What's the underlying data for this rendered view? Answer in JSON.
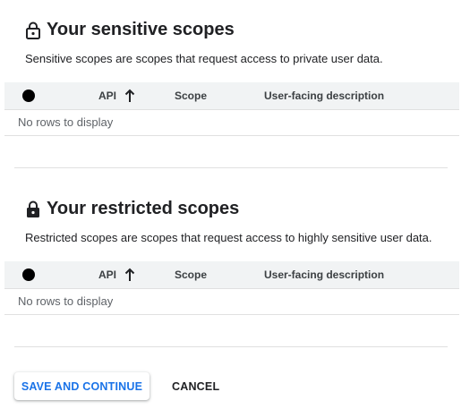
{
  "sensitive": {
    "title": "Your sensitive scopes",
    "title_icon": "lock-open-outline-icon",
    "description": "Sensitive scopes are scopes that request access to private user data.",
    "columns": [
      "API",
      "Scope",
      "User-facing description"
    ],
    "sort_icon": "arrow-up-icon",
    "empty_text": "No rows to display"
  },
  "restricted": {
    "title": "Your restricted scopes",
    "title_icon": "lock-filled-icon",
    "description": "Restricted scopes are scopes that request access to highly sensitive user data.",
    "columns": [
      "API",
      "Scope",
      "User-facing description"
    ],
    "sort_icon": "arrow-up-icon",
    "empty_text": "No rows to display"
  },
  "actions": {
    "save_label": "SAVE AND CONTINUE",
    "cancel_label": "CANCEL"
  },
  "colors": {
    "accent": "#1a73e8",
    "header_bg": "#f1f3f4",
    "divider": "#e0e0e0"
  }
}
